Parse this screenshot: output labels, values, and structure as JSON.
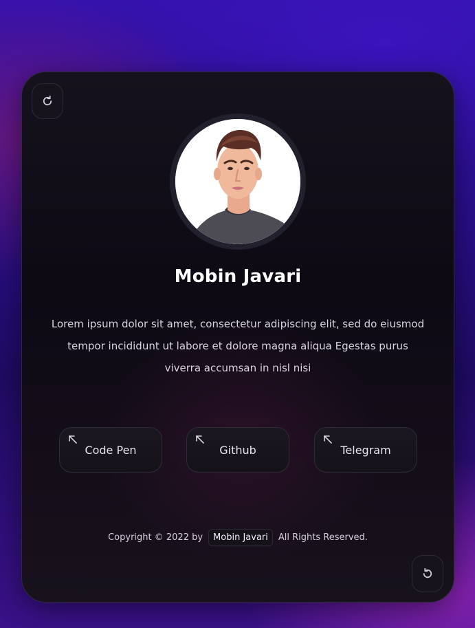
{
  "profile": {
    "name": "Mobin Javari",
    "bio": "Lorem ipsum dolor sit amet, consectetur adipiscing elit, sed do eiusmod tempor incididunt ut labore et dolore magna aliqua Egestas purus viverra accumsan in nisl nisi"
  },
  "links": [
    {
      "label": "Code Pen",
      "icon": "arrow-up-left-icon"
    },
    {
      "label": "Github",
      "icon": "arrow-up-left-icon"
    },
    {
      "label": "Telegram",
      "icon": "arrow-up-left-icon"
    }
  ],
  "controls": {
    "top_left_icon": "refresh-icon",
    "bottom_right_icon": "undo-icon"
  },
  "footer": {
    "prefix": "Copyright © 2022 by",
    "author": "Mobin Javari",
    "suffix": "All Rights Reserved."
  },
  "colors": {
    "background": "#2a0f8e",
    "card": "#0d0a14",
    "text": "#ffffff"
  }
}
